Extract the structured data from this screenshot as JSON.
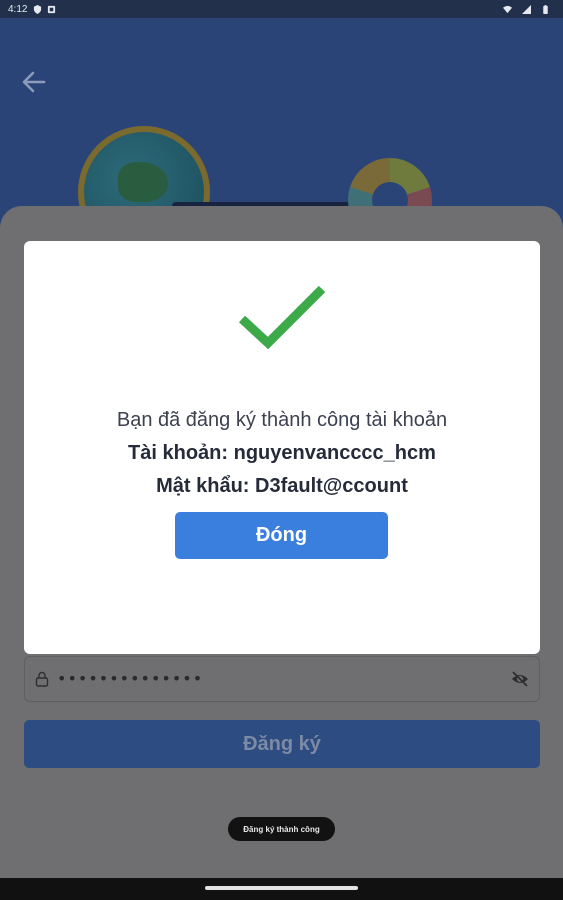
{
  "status_bar": {
    "time": "4:12"
  },
  "dialog": {
    "message": "Bạn đã đăng ký thành công tài khoản",
    "account_line": "Tài khoản: nguyenvancccc_hcm",
    "password_line": "Mật khẩu: D3fault@ccount",
    "close_label": "Đóng"
  },
  "form": {
    "password_masked": "••••••••••••••",
    "register_label": "Đăng ký"
  },
  "toast": {
    "text": "Đăng ký thành công"
  },
  "colors": {
    "accent": "#3a7ede",
    "success": "#3daa4a",
    "primary_dimmed": "#2d4c82"
  }
}
